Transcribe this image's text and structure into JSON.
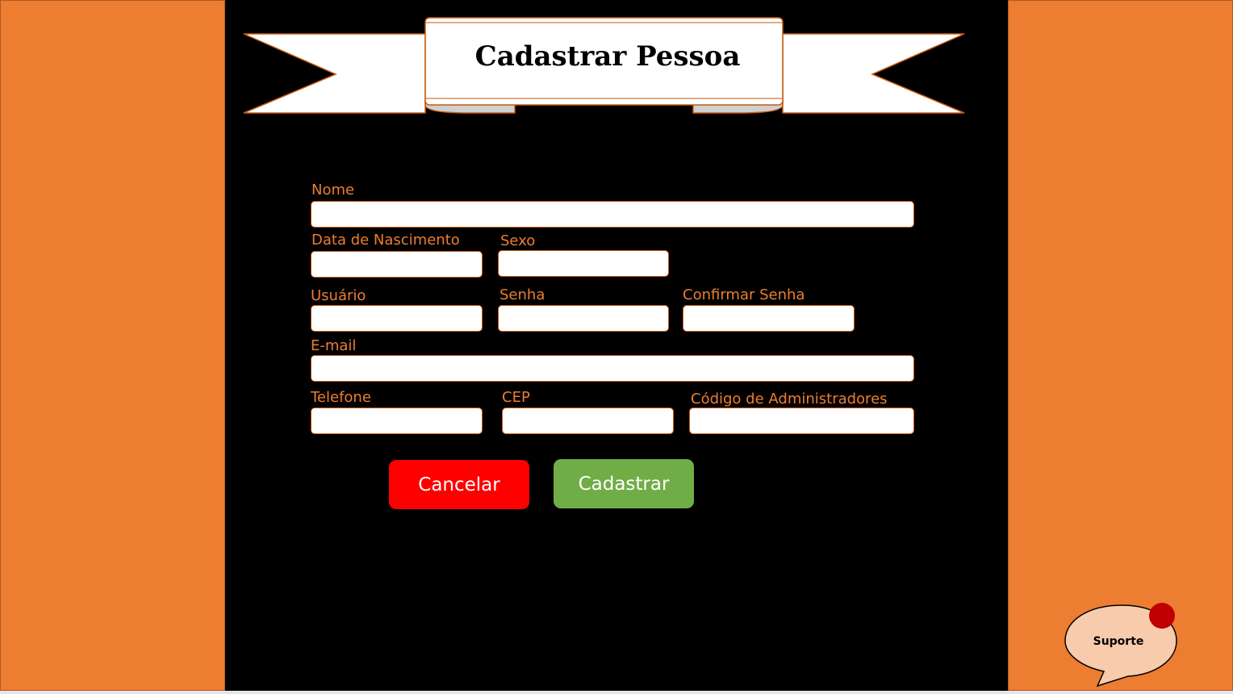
{
  "page": {
    "title": "Cadastrar Pessoa"
  },
  "form": {
    "nome": {
      "label": "Nome",
      "value": ""
    },
    "data_nascimento": {
      "label": "Data de Nascimento",
      "value": ""
    },
    "sexo": {
      "label": "Sexo",
      "value": ""
    },
    "usuario": {
      "label": "Usuário",
      "value": ""
    },
    "senha": {
      "label": "Senha",
      "value": ""
    },
    "confirmar_senha": {
      "label": "Confirmar Senha",
      "value": ""
    },
    "email": {
      "label": "E-mail",
      "value": ""
    },
    "telefone": {
      "label": "Telefone",
      "value": ""
    },
    "cep": {
      "label": "CEP",
      "value": ""
    },
    "codigo_admin": {
      "label": "Código de Administradores",
      "value": ""
    }
  },
  "actions": {
    "cancel_label": "Cancelar",
    "submit_label": "Cadastrar"
  },
  "support": {
    "label": "Suporte"
  },
  "colors": {
    "side_panel": "#ED7D31",
    "background": "#000000",
    "label_text": "#ED7D31",
    "cancel_button": "#FF0000",
    "submit_button": "#70AD47",
    "support_bubble": "#F8CBAD",
    "notification_dot": "#C00000"
  },
  "icons": {
    "banner": "ribbon-banner-icon",
    "support": "speech-bubble-icon",
    "notification": "notification-dot-icon"
  }
}
